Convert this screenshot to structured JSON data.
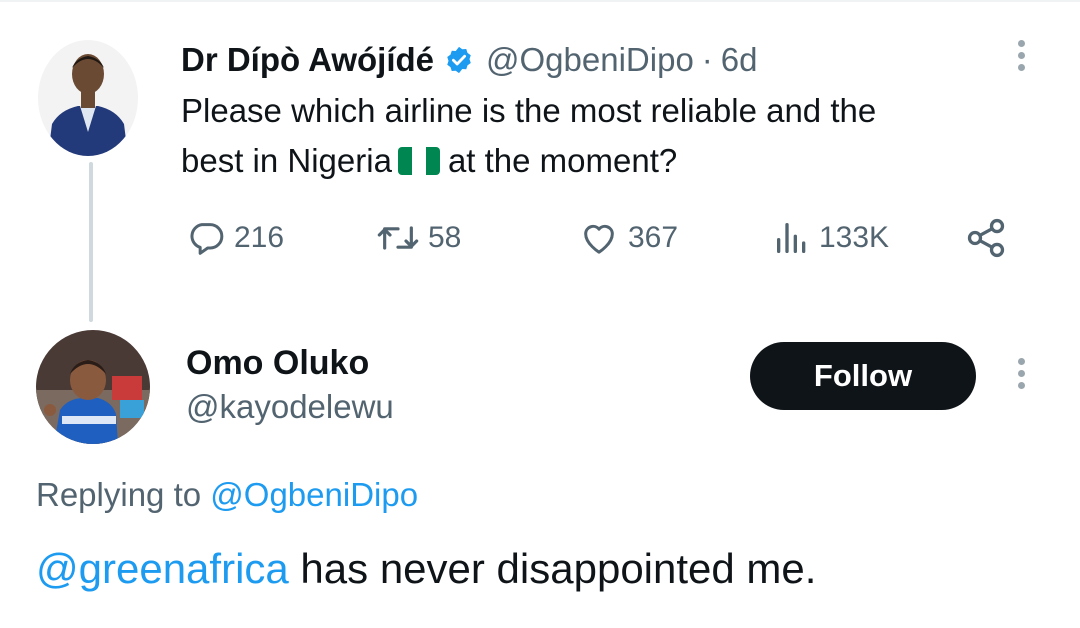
{
  "tweet": {
    "author_name": "Dr Dípò Awójídé",
    "author_handle": "@OgbeniDipo",
    "separator": "·",
    "time_ago": "6d",
    "text_line1": "Please which airline is the most reliable and the",
    "text_line2_before": "best in Nigeria",
    "text_line2_after": "at the moment?",
    "flag_icon": "nigeria-flag-icon",
    "verified_icon": "verified-badge-icon",
    "stats": {
      "replies": "216",
      "retweets": "58",
      "likes": "367",
      "views": "133K"
    },
    "colors": {
      "verified": "#1d9bf0",
      "flag_green": "#008751"
    }
  },
  "reply": {
    "author_name": "Omo Oluko",
    "author_handle": "@kayodelewu",
    "follow_label": "Follow",
    "replying_prefix": "Replying to",
    "replying_to": "@OgbeniDipo",
    "mention": "@greenafrica",
    "text": " has never disappointed me."
  },
  "theme": {
    "text": "#0f1419",
    "muted": "#536471",
    "link": "#1d9bf0",
    "button_bg": "#0f1419"
  }
}
